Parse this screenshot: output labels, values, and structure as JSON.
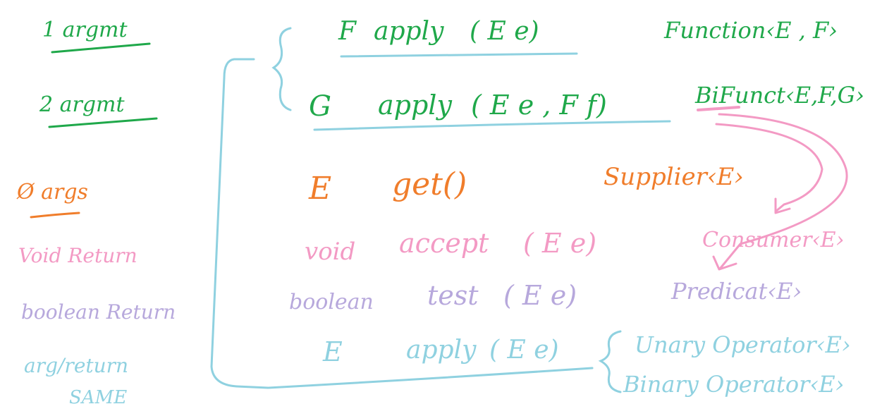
{
  "colors": {
    "green": "#1fa84a",
    "orange": "#f07d2b",
    "pink": "#f39ac4",
    "purple": "#b7a8dc",
    "cyan": "#8fd1e0",
    "background": "#ffffff"
  },
  "left_notes": {
    "one_arg": "1 argmt",
    "two_arg": "2 argmt",
    "zero_args": "Ø args",
    "void_return": "Void Return",
    "boolean_return": "boolean Return",
    "arg_return": "arg/return",
    "same": "SAME"
  },
  "rows": {
    "function": {
      "ret": "F",
      "method": "apply",
      "params": "( E  e)",
      "iface": "Function‹E , F›"
    },
    "bifunction": {
      "ret": "G",
      "method": "apply",
      "params": "( E  e , F  f)",
      "iface": "BiFunct‹E,F,G›"
    },
    "supplier": {
      "ret": "E",
      "method": "get()",
      "iface": "Supplier‹E›"
    },
    "consumer": {
      "ret": "void",
      "method": "accept",
      "params": "( E   e)",
      "iface": "Consumer‹E›"
    },
    "predicate": {
      "ret": "boolean",
      "method": "test",
      "params": "( E   e)",
      "iface": "Predicat‹E›"
    },
    "unary": {
      "ret": "E",
      "method": "apply",
      "params": "( E  e)",
      "iface": "Unary Operator‹E›"
    },
    "binary": {
      "iface": "Binary Operator‹E›"
    }
  }
}
